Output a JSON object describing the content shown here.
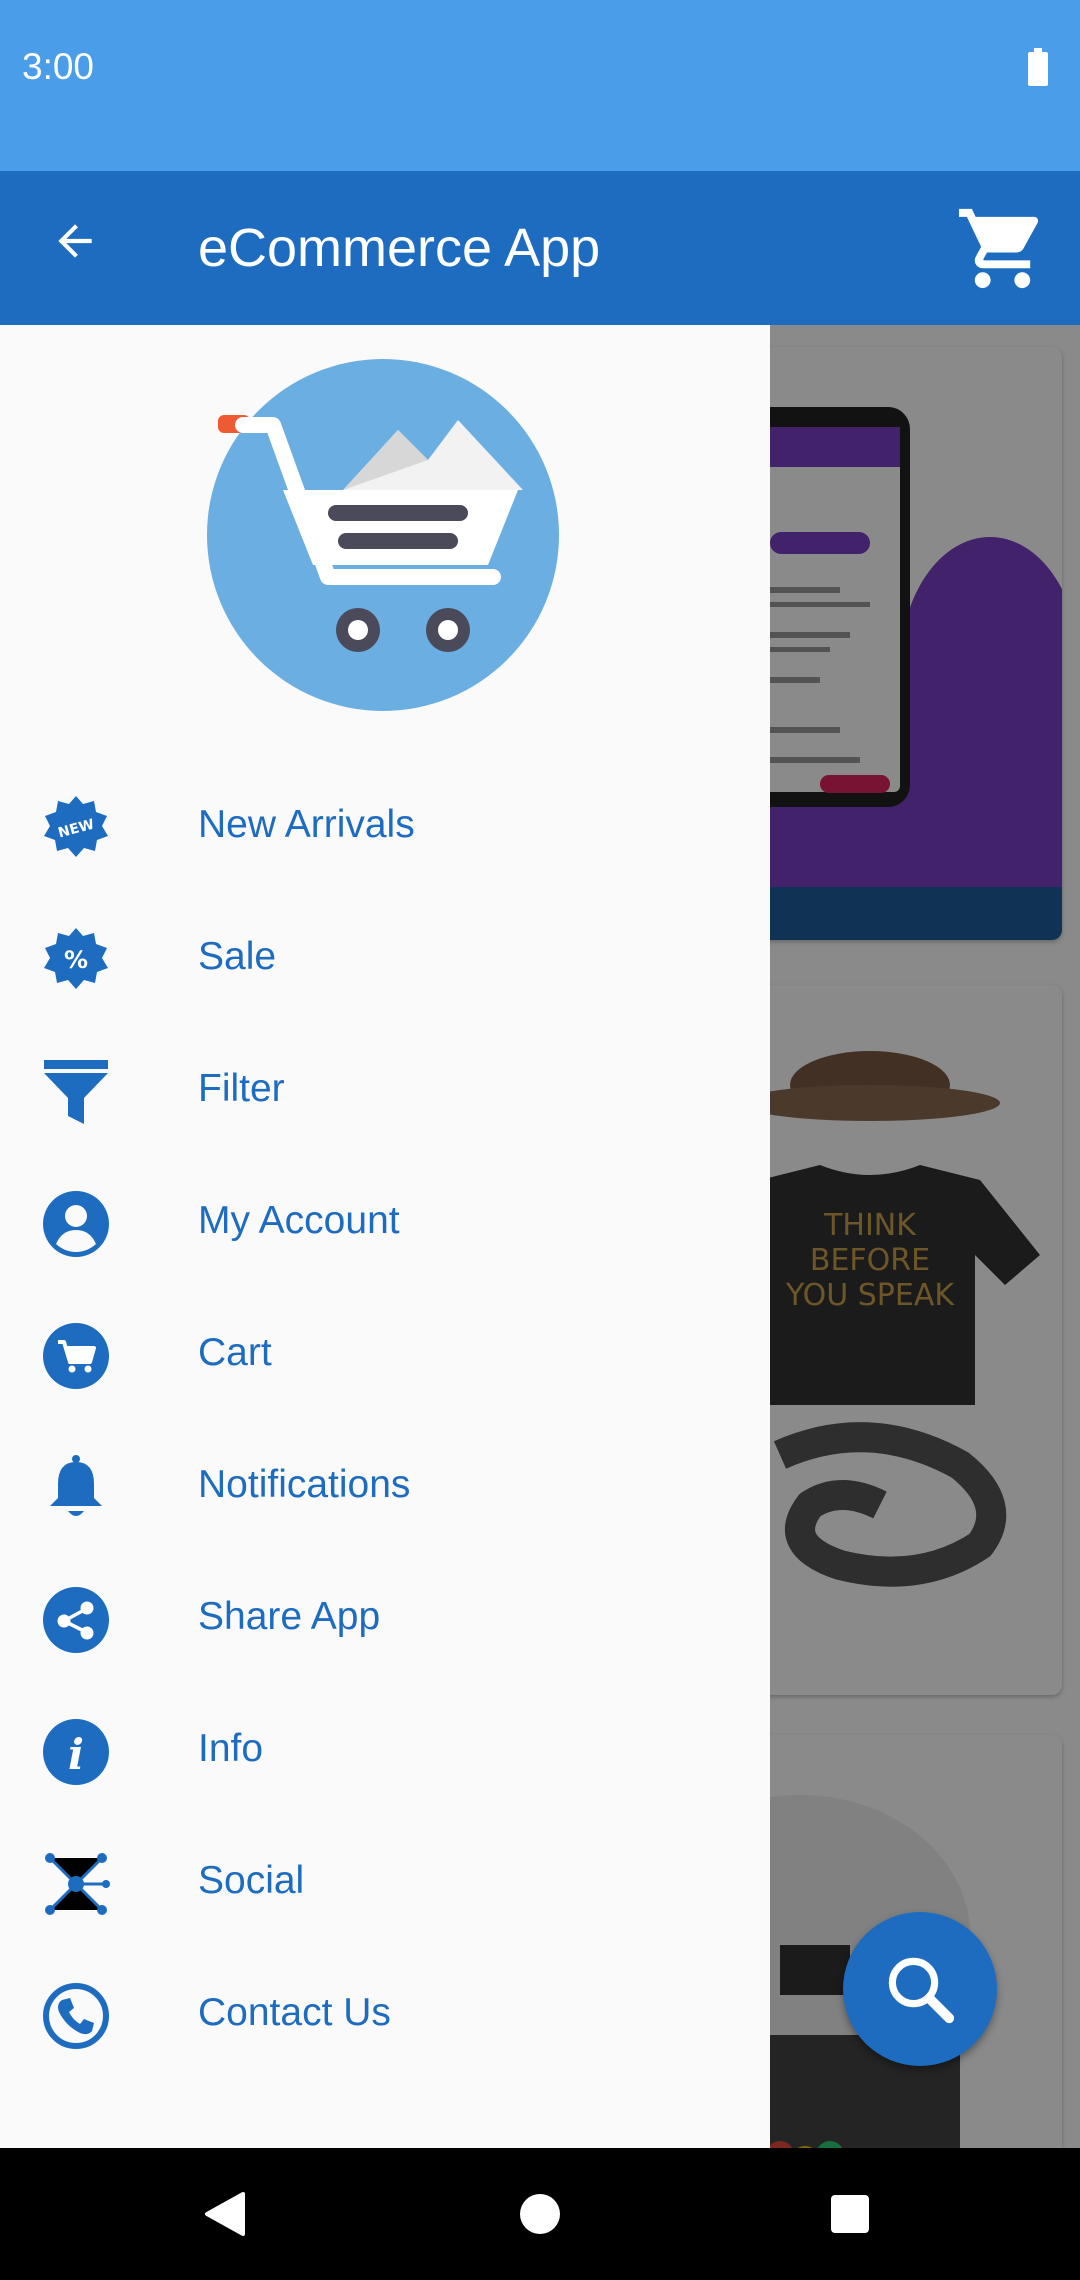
{
  "status_bar": {
    "time": "3:00"
  },
  "app_bar": {
    "title": "eCommerce App"
  },
  "drawer": {
    "items": [
      {
        "label": "New Arrivals",
        "icon": "new-badge-icon"
      },
      {
        "label": "Sale",
        "icon": "percent-badge-icon"
      },
      {
        "label": "Filter",
        "icon": "filter-icon"
      },
      {
        "label": "My Account",
        "icon": "account-icon"
      },
      {
        "label": "Cart",
        "icon": "cart-icon"
      },
      {
        "label": "Notifications",
        "icon": "bell-icon"
      },
      {
        "label": "Share App",
        "icon": "share-icon"
      },
      {
        "label": "Info",
        "icon": "info-icon"
      },
      {
        "label": "Social",
        "icon": "social-icon"
      },
      {
        "label": "Contact Us",
        "icon": "phone-icon"
      }
    ]
  },
  "colors": {
    "primary": "#1e6cc0",
    "status_bar": "#4a9de9",
    "drawer_bg": "#fafafa"
  }
}
